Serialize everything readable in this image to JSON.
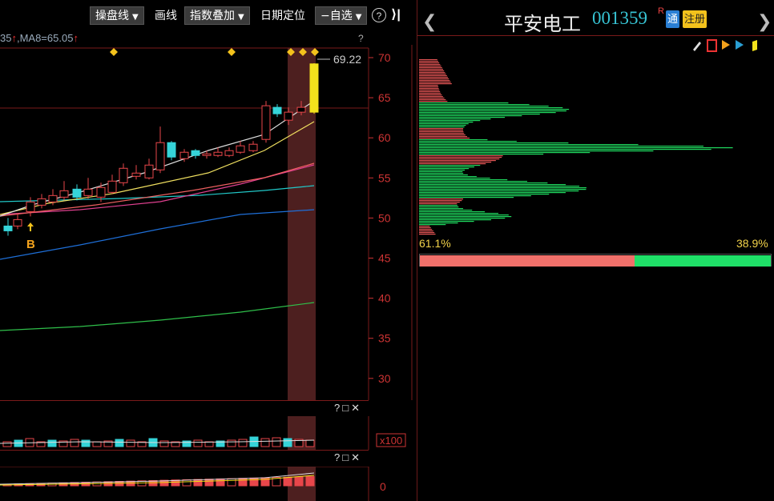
{
  "toolbar": {
    "btn_caopan": "操盘线",
    "btn_huaxian": "画线",
    "btn_zhishu": "指数叠加",
    "btn_riqi": "日期定位",
    "btn_zixuan": "−自选",
    "help": "?",
    "collapse": "⟩|"
  },
  "ma_legend": {
    "prefix": "35",
    "prefix_arrow": "↑",
    "ma8": ",MA8=65.05",
    "ma8_arrow": "↑"
  },
  "help_mark": "?",
  "price_label": "69.22",
  "y_axis": [
    "70",
    "65",
    "60",
    "55",
    "50",
    "45",
    "40",
    "35",
    "30"
  ],
  "signal_label": "B",
  "sub1": {
    "tools": "?□✕",
    "axis": "x100"
  },
  "sub2": {
    "tools": "?□✕",
    "axis": "0"
  },
  "stock": {
    "name": "平安电工",
    "code": "001359",
    "sup": "R",
    "tag_tong": "通",
    "tag_zhuce": "注册",
    "prev": "❮",
    "next": "❯"
  },
  "chip": {
    "profit_pct": "61.1%",
    "loss_pct": "38.9%",
    "profit_ratio": 0.611
  },
  "colors": {
    "up": "#e8464a",
    "down": "#35d4d9",
    "chip_red": "#e45555",
    "chip_green": "#1fd95f",
    "axis": "#c33"
  }
}
